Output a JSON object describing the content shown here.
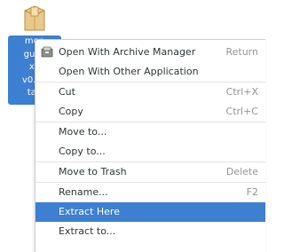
{
  "desktop_file": {
    "label_lines": [
      "mon",
      "gui-li",
      "x6",
      "v0.16",
      "tar."
    ],
    "icon": "archive-package-icon"
  },
  "menu": {
    "items": [
      {
        "label": "Open With Archive Manager",
        "accel": "Return",
        "icon": "archive-manager-icon"
      },
      {
        "label": "Open With Other Application",
        "accel": ""
      },
      {
        "label": "Cut",
        "accel": "Ctrl+X"
      },
      {
        "label": "Copy",
        "accel": "Ctrl+C"
      },
      {
        "label": "Move to...",
        "accel": ""
      },
      {
        "label": "Copy to...",
        "accel": ""
      },
      {
        "label": "Move to Trash",
        "accel": "Delete"
      },
      {
        "label": "Rename...",
        "accel": "F2"
      },
      {
        "label": "Extract Here",
        "accel": "",
        "highlighted": true
      },
      {
        "label": "Extract to...",
        "accel": ""
      }
    ]
  },
  "colors": {
    "selection": "#3d7fd1",
    "text": "#2e3436",
    "accel_text": "#929595"
  }
}
